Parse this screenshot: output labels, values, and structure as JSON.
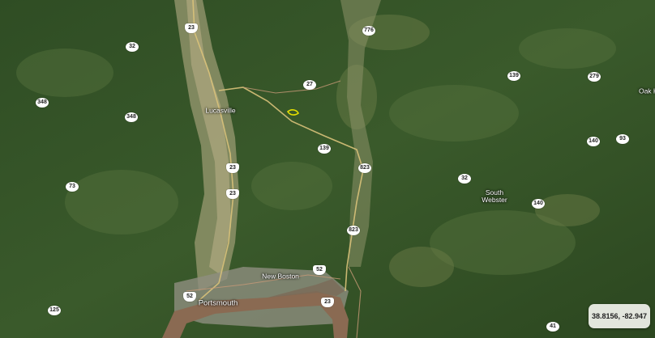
{
  "map": {
    "coordinates": "38.8156, -82.947",
    "places": [
      {
        "id": "lucasville",
        "name": "Lucasville",
        "kind": "town"
      },
      {
        "id": "new-boston",
        "name": "New Boston",
        "kind": "town"
      },
      {
        "id": "portsmouth",
        "name": "Portsmouth",
        "kind": "city"
      },
      {
        "id": "south-webster",
        "name": "South\nWebster",
        "kind": "town"
      },
      {
        "id": "oak-hill",
        "name": "Oak H",
        "kind": "town"
      }
    ],
    "route_shields": [
      {
        "id": "23-a",
        "label": "23",
        "type": "us"
      },
      {
        "id": "32",
        "label": "32",
        "type": "state"
      },
      {
        "id": "776",
        "label": "776",
        "type": "state"
      },
      {
        "id": "348-a",
        "label": "348",
        "type": "state"
      },
      {
        "id": "348-b",
        "label": "348",
        "type": "state"
      },
      {
        "id": "27",
        "label": "27",
        "type": "state"
      },
      {
        "id": "139-a",
        "label": "139",
        "type": "state"
      },
      {
        "id": "279",
        "label": "279",
        "type": "state"
      },
      {
        "id": "139-b",
        "label": "139",
        "type": "state"
      },
      {
        "id": "140",
        "label": "140",
        "type": "state"
      },
      {
        "id": "93",
        "label": "93",
        "type": "state"
      },
      {
        "id": "823-a",
        "label": "823",
        "type": "state"
      },
      {
        "id": "23-b",
        "label": "23",
        "type": "us"
      },
      {
        "id": "23-c",
        "label": "23",
        "type": "us"
      },
      {
        "id": "73",
        "label": "73",
        "type": "state"
      },
      {
        "id": "32-b",
        "label": "32",
        "type": "state"
      },
      {
        "id": "140-b",
        "label": "140",
        "type": "state"
      },
      {
        "id": "823-b",
        "label": "823",
        "type": "state"
      },
      {
        "id": "52-a",
        "label": "52",
        "type": "us"
      },
      {
        "id": "52-b",
        "label": "52",
        "type": "us"
      },
      {
        "id": "23-d",
        "label": "23",
        "type": "us"
      },
      {
        "id": "125",
        "label": "125",
        "type": "state"
      },
      {
        "id": "41",
        "label": "41",
        "type": "state"
      }
    ]
  }
}
